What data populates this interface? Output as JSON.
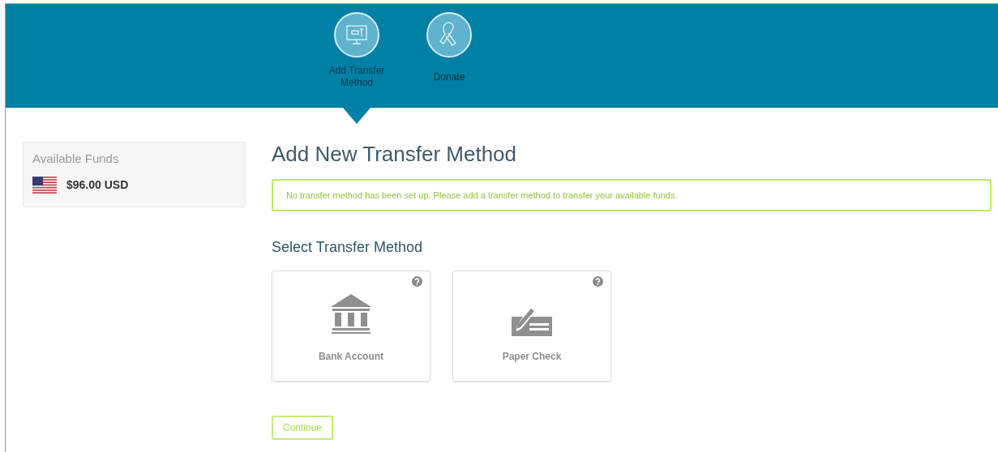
{
  "steps": [
    {
      "label": "Add Transfer Method",
      "kind": "monitor",
      "selected": true
    },
    {
      "label": "Donate",
      "kind": "ribbon",
      "selected": false
    }
  ],
  "funds": {
    "title": "Available Funds",
    "amount": "$96.00 USD"
  },
  "page_title": "Add New Transfer Method",
  "alert": "No transfer method has been set up. Please add a transfer method to transfer your available funds.",
  "section_title": "Select Transfer Method",
  "methods": [
    {
      "label": "Bank Account",
      "kind": "bank"
    },
    {
      "label": "Paper Check",
      "kind": "check"
    }
  ],
  "continue_button": "Continue"
}
